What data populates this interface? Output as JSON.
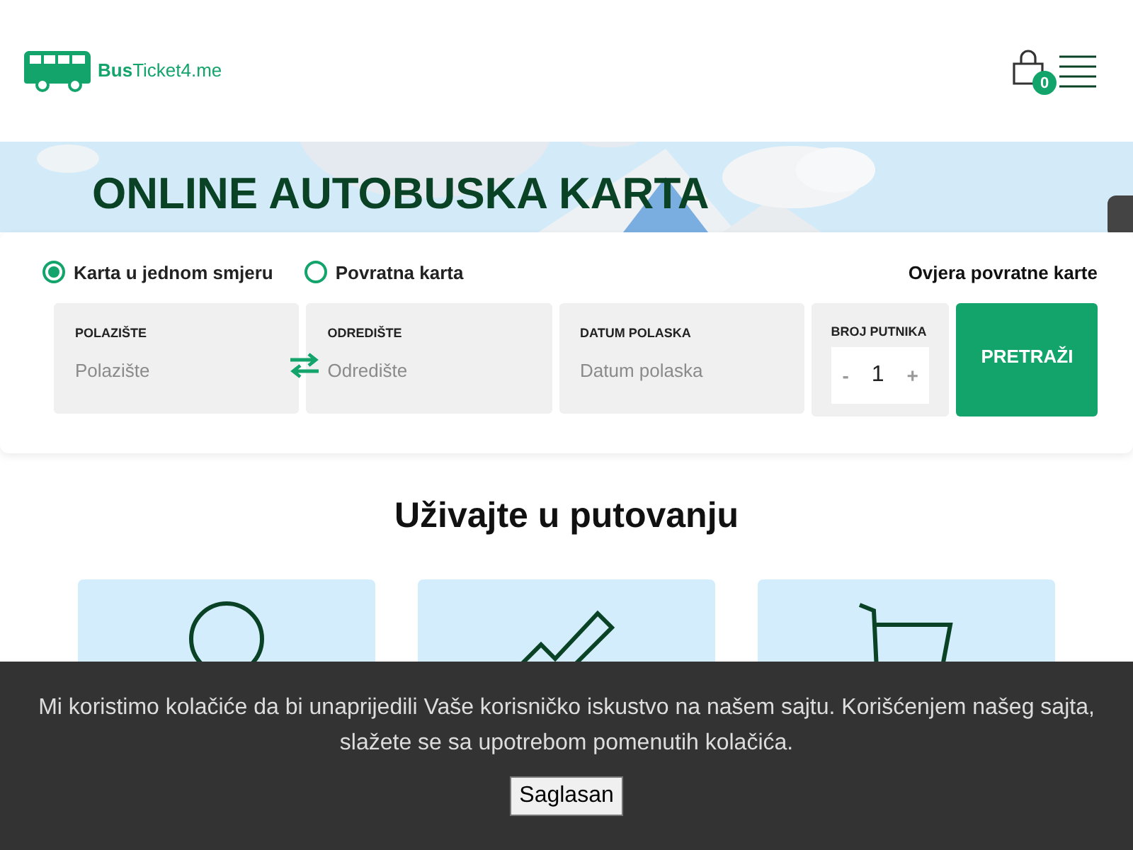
{
  "header": {
    "logo_bold": "Bus",
    "logo_light": "Ticket4.me",
    "cart_count": "0"
  },
  "hero": {
    "title": "ONLINE AUTOBUSKA KARTA"
  },
  "search": {
    "trip_types": [
      {
        "label": "Karta u jednom smjeru",
        "selected": true
      },
      {
        "label": "Povratna karta",
        "selected": false
      }
    ],
    "validate_link": "Ovjera povratne karte",
    "fields": [
      {
        "label": "POLAZIŠTE",
        "placeholder": "Polazište"
      },
      {
        "label": "ODREDIŠTE",
        "placeholder": "Odredište"
      },
      {
        "label": "DATUM POLASKA",
        "placeholder": "Datum polaska"
      }
    ],
    "passengers": {
      "label": "BROJ PUTNIKA",
      "minus": "-",
      "value": "1",
      "plus": "+"
    },
    "submit": "PRETRAŽI"
  },
  "features": {
    "title": "Uživajte u putovanju",
    "cards": [
      {
        "kind": "circle"
      },
      {
        "kind": "check"
      },
      {
        "kind": "cart"
      }
    ]
  },
  "cookie_bar": {
    "text": "Mi koristimo kolačiće da bi unaprijedili Vaše korisničko iskustvo na našem sajtu. Korišćenjem našeg sajta, slažete se sa upotrebom pomenutih kolačića.",
    "button": "Saglasan"
  }
}
